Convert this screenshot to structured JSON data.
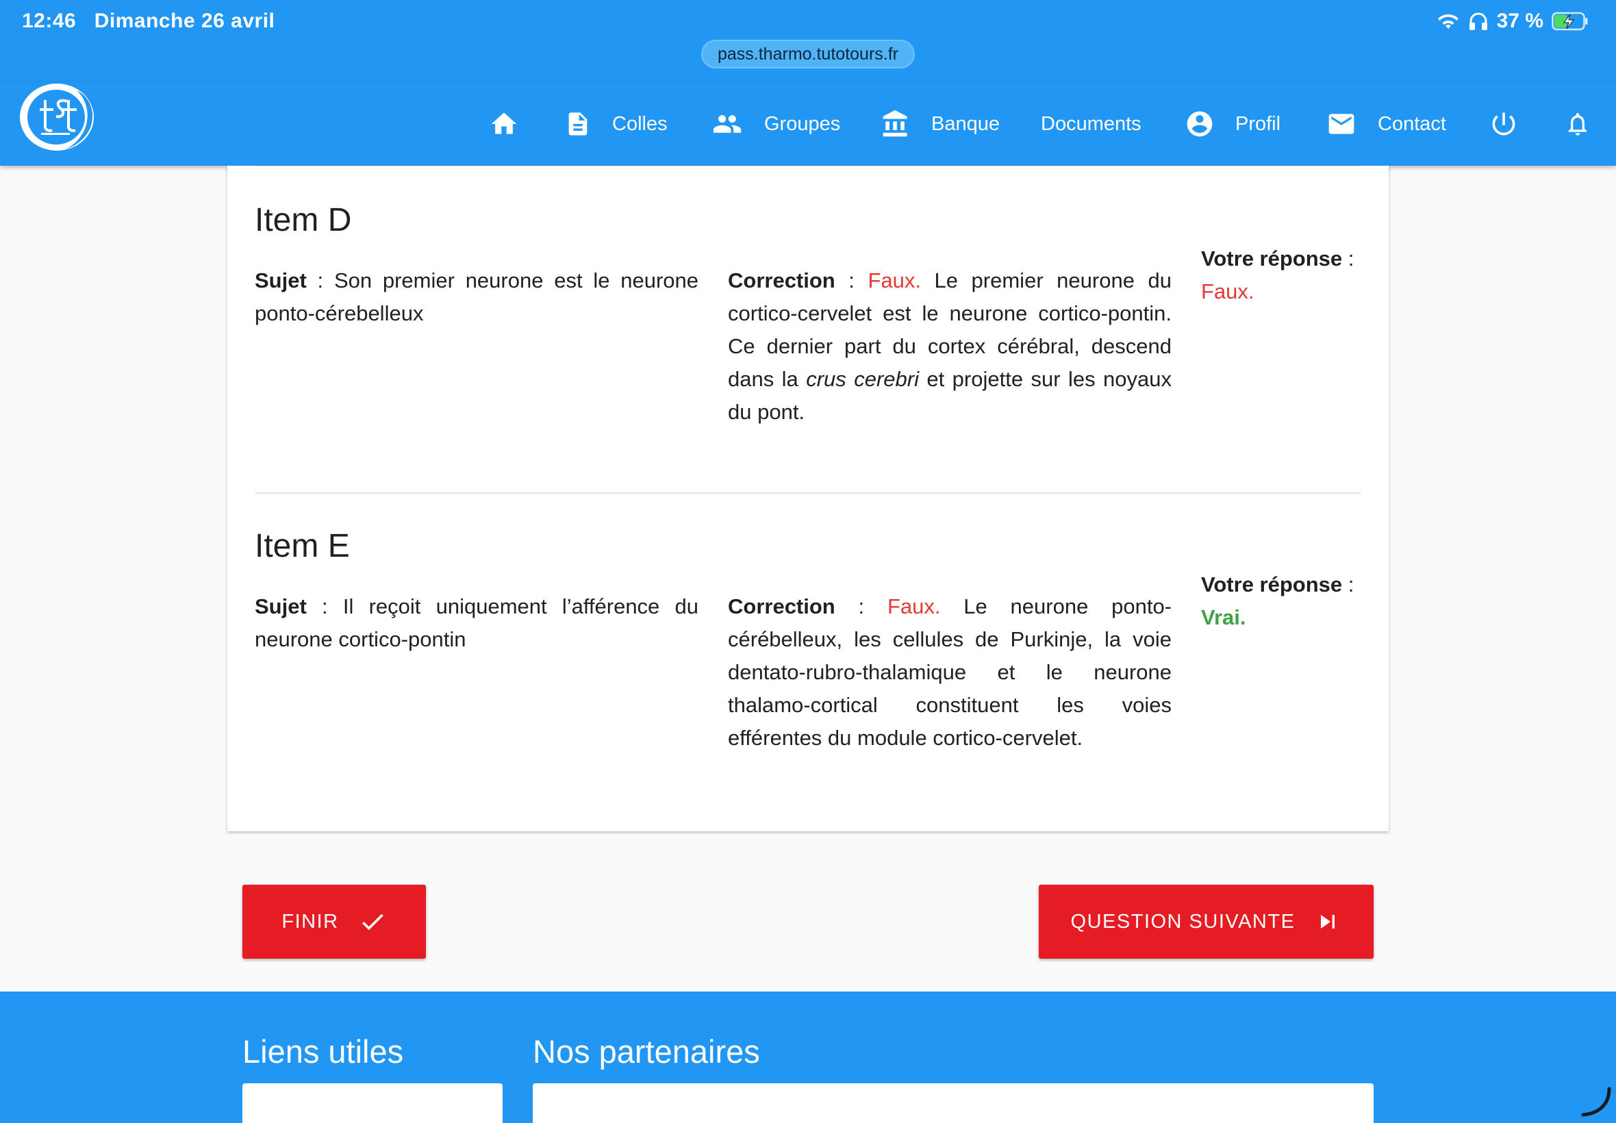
{
  "status_bar": {
    "time": "12:46",
    "date": "Dimanche 26 avril",
    "battery": "37 %"
  },
  "browser": {
    "url": "pass.tharmo.tutotours.fr"
  },
  "nav": {
    "colles": "Colles",
    "groupes": "Groupes",
    "banque": "Banque",
    "documents": "Documents",
    "profil": "Profil",
    "contact": "Contact"
  },
  "items": [
    {
      "title": "Item D",
      "sujet_label": "Sujet",
      "sujet_text": "Son premier neurone est le neurone ponto-cérebelleux",
      "correction_label": "Correction",
      "correction_verdict": "Faux.",
      "correction_text_1": "Le premier neurone du cortico-cervelet est le neurone cortico-pontin. Ce dernier part du cortex cérébral, descend dans la",
      "correction_italic": "crus cerebri",
      "correction_text_2": "et projette sur les noyaux du pont.",
      "reponse_label": "Votre réponse",
      "reponse_value": "Faux."
    },
    {
      "title": "Item E",
      "sujet_label": "Sujet",
      "sujet_text": "Il reçoit uniquement l’afférence du neurone cortico-pontin",
      "correction_label": "Correction",
      "correction_verdict": "Faux.",
      "correction_text_1": "Le neurone ponto-cérébelleux, les cellules de Purkinje, la voie dentato-rubro-thalamique et le neurone thalamo-cortical constituent les voies efférentes du module cortico-cervelet.",
      "reponse_label": "Votre réponse",
      "reponse_value": "Vrai."
    }
  ],
  "buttons": {
    "finir": "FINIR",
    "next": "QUESTION SUIVANTE"
  },
  "footer": {
    "liens": "Liens utiles",
    "partenaires": "Nos partenaires"
  },
  "colors": {
    "primary": "#2196f3",
    "accent": "#e51c23",
    "wrong": "#e53935",
    "right": "#43a047"
  }
}
